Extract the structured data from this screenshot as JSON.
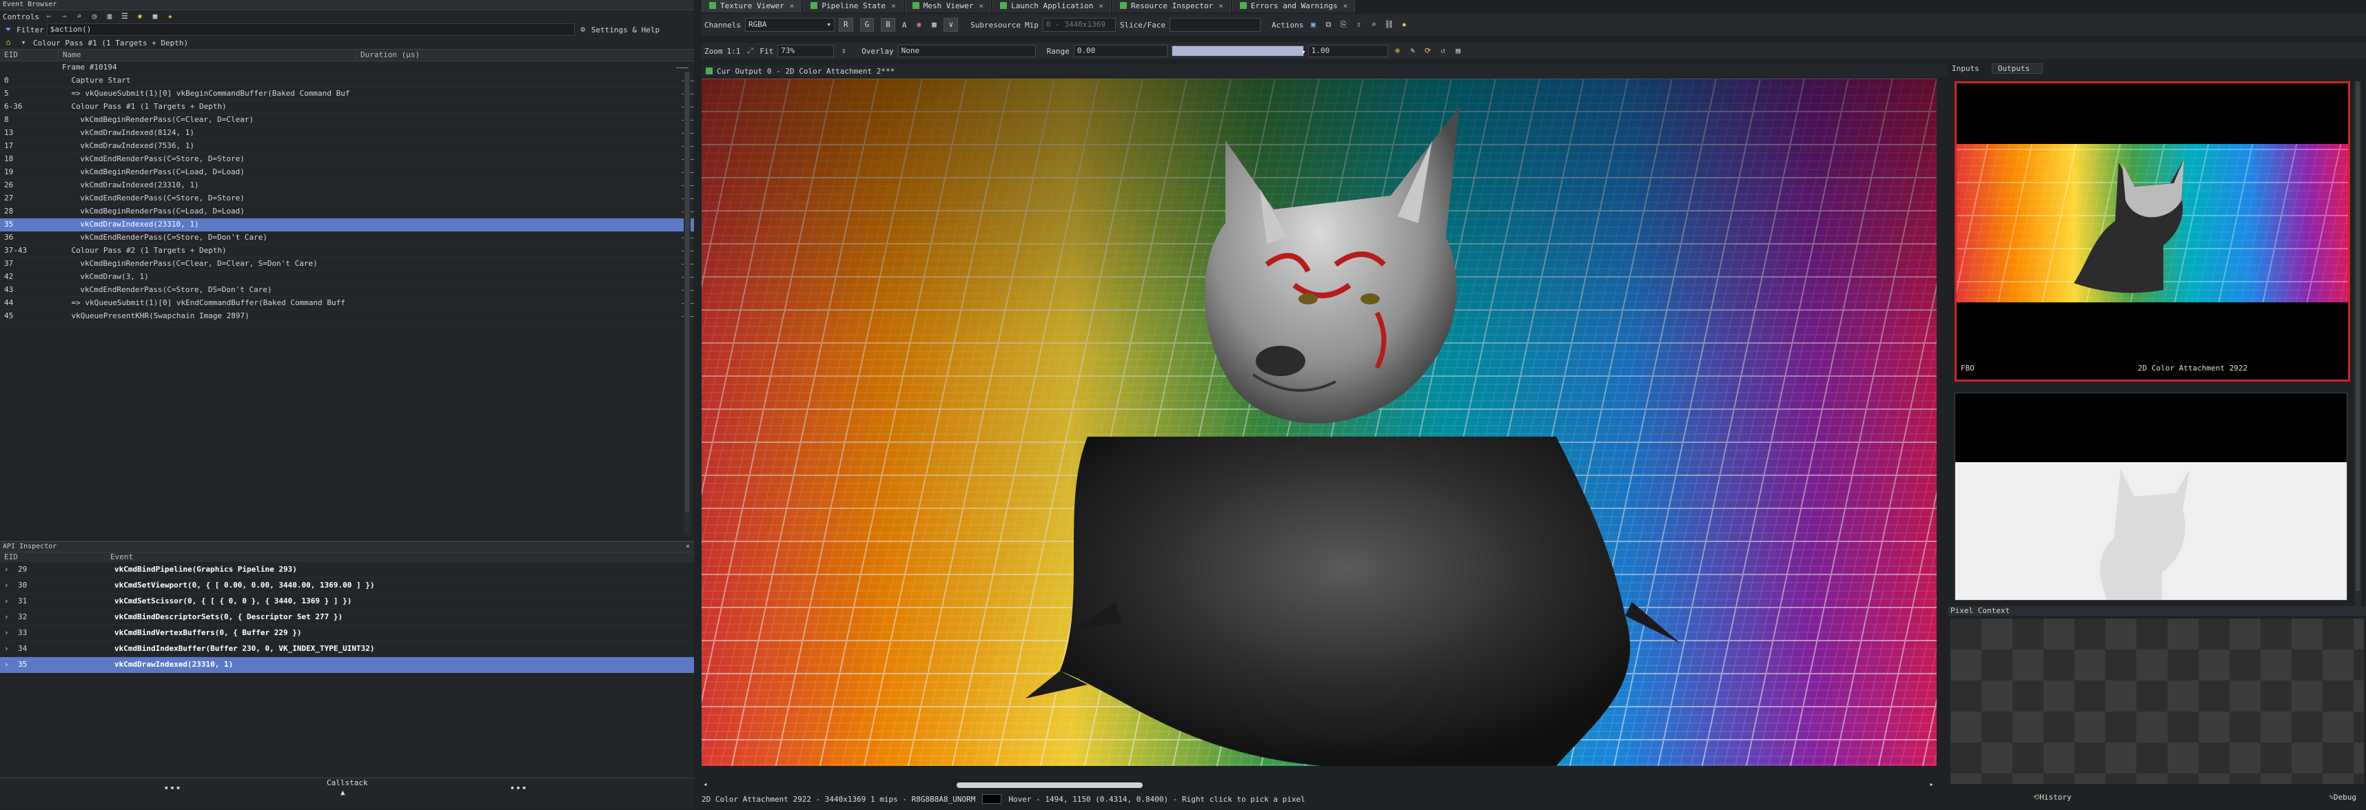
{
  "event_browser": {
    "title": "Event Browser",
    "controls_label": "Controls",
    "filter_label": "Filter",
    "filter_value": "$action()",
    "settings_label": "Settings & Help",
    "pass_label": "Colour Pass #1 (1 Targets + Depth)",
    "columns": {
      "eid": "EID",
      "name": "Name",
      "duration": "Duration (μs)"
    },
    "rows": [
      {
        "eid": "",
        "name": "Frame #10194",
        "selected": false,
        "indent": 0
      },
      {
        "eid": "0",
        "name": "Capture Start",
        "selected": false,
        "indent": 1
      },
      {
        "eid": "5",
        "name": "=> vkQueueSubmit(1)[0]   vkBeginCommandBuffer(Baked Command Buf",
        "selected": false,
        "indent": 1
      },
      {
        "eid": "6-36",
        "name": "Colour Pass #1 (1 Targets + Depth)",
        "selected": false,
        "indent": 1
      },
      {
        "eid": "8",
        "name": "vkCmdBeginRenderPass(C=Clear, D=Clear)",
        "selected": false,
        "indent": 2
      },
      {
        "eid": "13",
        "name": "vkCmdDrawIndexed(8124, 1)",
        "selected": false,
        "indent": 2
      },
      {
        "eid": "17",
        "name": "vkCmdDrawIndexed(7536, 1)",
        "selected": false,
        "indent": 2
      },
      {
        "eid": "18",
        "name": "vkCmdEndRenderPass(C=Store, D=Store)",
        "selected": false,
        "indent": 2
      },
      {
        "eid": "19",
        "name": "vkCmdBeginRenderPass(C=Load, D=Load)",
        "selected": false,
        "indent": 2
      },
      {
        "eid": "26",
        "name": "vkCmdDrawIndexed(23310, 1)",
        "selected": false,
        "indent": 2
      },
      {
        "eid": "27",
        "name": "vkCmdEndRenderPass(C=Store, D=Store)",
        "selected": false,
        "indent": 2
      },
      {
        "eid": "28",
        "name": "vkCmdBeginRenderPass(C=Load, D=Load)",
        "selected": false,
        "indent": 2
      },
      {
        "eid": "35",
        "name": "vkCmdDrawIndexed(23310, 1)",
        "selected": true,
        "indent": 2
      },
      {
        "eid": "36",
        "name": "vkCmdEndRenderPass(C=Store, D=Don't Care)",
        "selected": false,
        "indent": 2
      },
      {
        "eid": "37-43",
        "name": "Colour Pass #2 (1 Targets + Depth)",
        "selected": false,
        "indent": 1
      },
      {
        "eid": "37",
        "name": "vkCmdBeginRenderPass(C=Clear, D=Clear, S=Don't Care)",
        "selected": false,
        "indent": 2
      },
      {
        "eid": "42",
        "name": "vkCmdDraw(3, 1)",
        "selected": false,
        "indent": 2
      },
      {
        "eid": "43",
        "name": "vkCmdEndRenderPass(C=Store, DS=Don't Care)",
        "selected": false,
        "indent": 2
      },
      {
        "eid": "44",
        "name": "=> vkQueueSubmit(1)[0]   vkEndCommandBuffer(Baked Command Buff",
        "selected": false,
        "indent": 1
      },
      {
        "eid": "45",
        "name": "vkQueuePresentKHR(Swapchain Image 2897)",
        "selected": false,
        "indent": 1
      }
    ]
  },
  "api_inspector": {
    "title": "API Inspector",
    "columns": {
      "eid": "EID",
      "event": "Event"
    },
    "rows": [
      {
        "eid": "29",
        "event": "vkCmdBindPipeline(Graphics Pipeline 293)",
        "selected": false
      },
      {
        "eid": "30",
        "event": "vkCmdSetViewport(0, { [ 0.00, 0.00, 3440.00, 1369.00 ] })",
        "selected": false
      },
      {
        "eid": "31",
        "event": "vkCmdSetScissor(0, { [ { 0, 0 }, { 3440, 1369 } ] })",
        "selected": false
      },
      {
        "eid": "32",
        "event": "vkCmdBindDescriptorSets(0, {  Descriptor Set 277  })",
        "selected": false
      },
      {
        "eid": "33",
        "event": "vkCmdBindVertexBuffers(0, {  Buffer 229  })",
        "selected": false
      },
      {
        "eid": "34",
        "event": "vkCmdBindIndexBuffer(Buffer 230, 0, VK_INDEX_TYPE_UINT32)",
        "selected": false
      },
      {
        "eid": "35",
        "event": "vkCmdDrawIndexed(23310, 1)",
        "selected": true
      }
    ],
    "callstack_label": "Callstack"
  },
  "tabs": [
    {
      "label": "Texture Viewer",
      "active": true
    },
    {
      "label": "Pipeline State",
      "active": false
    },
    {
      "label": "Mesh Viewer",
      "active": false
    },
    {
      "label": "Launch Application",
      "active": false
    },
    {
      "label": "Resource Inspector",
      "active": false
    },
    {
      "label": "Errors and Warnings",
      "active": false
    }
  ],
  "texture_toolbar": {
    "channels_label": "Channels",
    "channels_value": "RGBA",
    "r": "R",
    "g": "G",
    "b": "B",
    "a": "A",
    "subresource_label": "Subresource",
    "mip_label": "Mip",
    "mip_value": "0 - 3440x1369",
    "slice_label": "Slice/Face",
    "actions_label": "Actions",
    "zoom_label": "Zoom",
    "zoom_11": "1:1",
    "fit_label": "Fit",
    "zoom_value": "73%",
    "overlay_label": "Overlay",
    "overlay_value": "None",
    "range_label": "Range",
    "range_min": "0.00",
    "range_max": "1.00"
  },
  "viewer": {
    "output_label": "Cur Output 0 - 2D Color Attachment 2***",
    "status": "2D Color Attachment 2922 - 3440x1369 1 mips - R8G8B8A8_UNORM",
    "hover": "Hover - 1494, 1150 (0.4314, 0.8400) - Right click to pick a pixel"
  },
  "thumbnails": {
    "inputs_tab": "Inputs",
    "outputs_tab": "Outputs",
    "thumb1_left": "FBO",
    "thumb1_right": "2D Color Attachment 2922",
    "pixel_context_label": "Pixel Context",
    "history_label": "History",
    "debug_label": "Debug"
  },
  "colors": {
    "accent_select": "#5b79c7",
    "active_border": "#c62828",
    "tab_green": "#4caf50"
  }
}
